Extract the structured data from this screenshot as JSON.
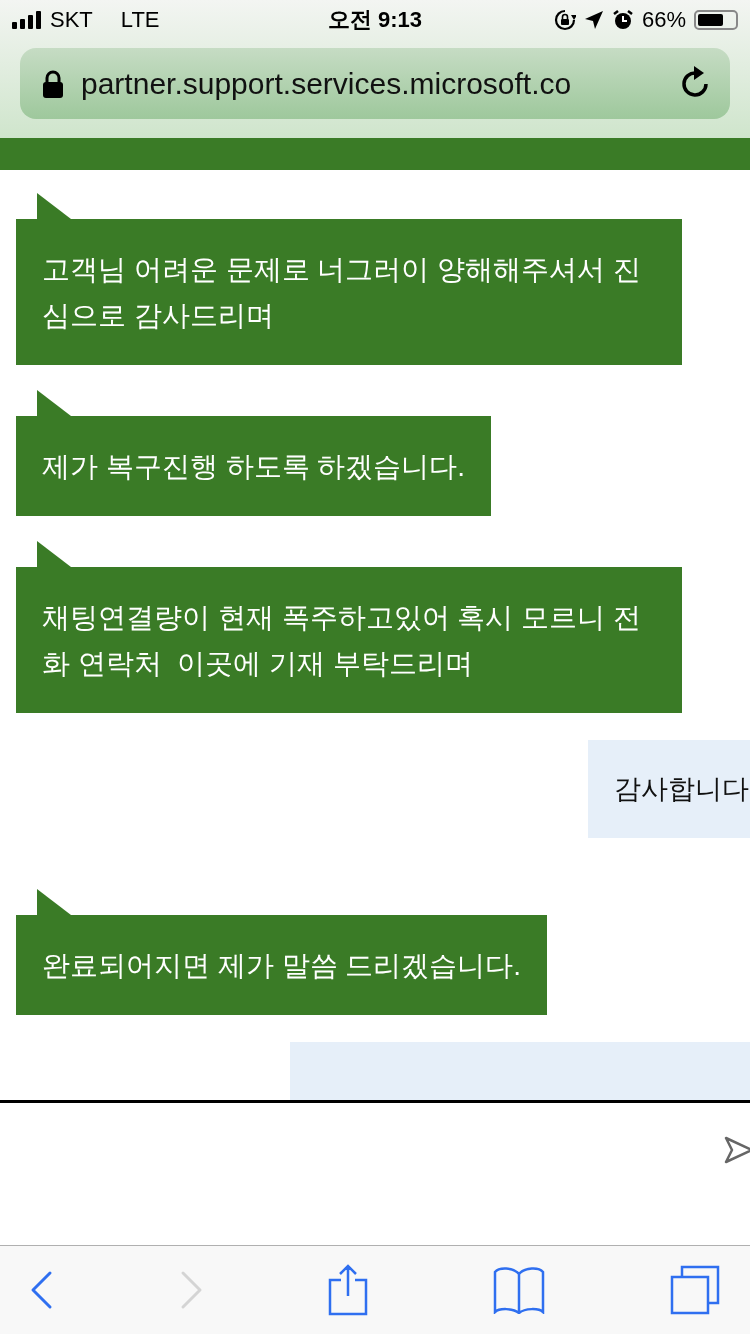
{
  "status_bar": {
    "carrier": "SKT",
    "network": "LTE",
    "time": "오전 9:13",
    "battery": "66%"
  },
  "address_bar": {
    "url": "partner.support.services.microsoft.co"
  },
  "messages": [
    {
      "kind": "agent",
      "text": "고객님 어려운 문제로 너그러이 양해해주셔서 진심으로 감사드리며"
    },
    {
      "kind": "agent",
      "text": "제가 복구진행 하도록 하겠습니다."
    },
    {
      "kind": "agent",
      "text": "채팅연결량이 현재 폭주하고있어 혹시 모르니 전화 연락처  이곳에 기재 부탁드리며"
    },
    {
      "kind": "user",
      "text": "감사합니다"
    },
    {
      "kind": "agent",
      "text": "완료되어지면 제가 말씀 드리겠습니다."
    },
    {
      "kind": "user"
    }
  ],
  "toolbar": [
    {
      "kind": "back",
      "disabled": false
    },
    {
      "kind": "forward",
      "disabled": true
    },
    {
      "kind": "share",
      "disabled": false
    },
    {
      "kind": "bookmarks",
      "disabled": false
    },
    {
      "kind": "tabs",
      "disabled": false
    }
  ]
}
